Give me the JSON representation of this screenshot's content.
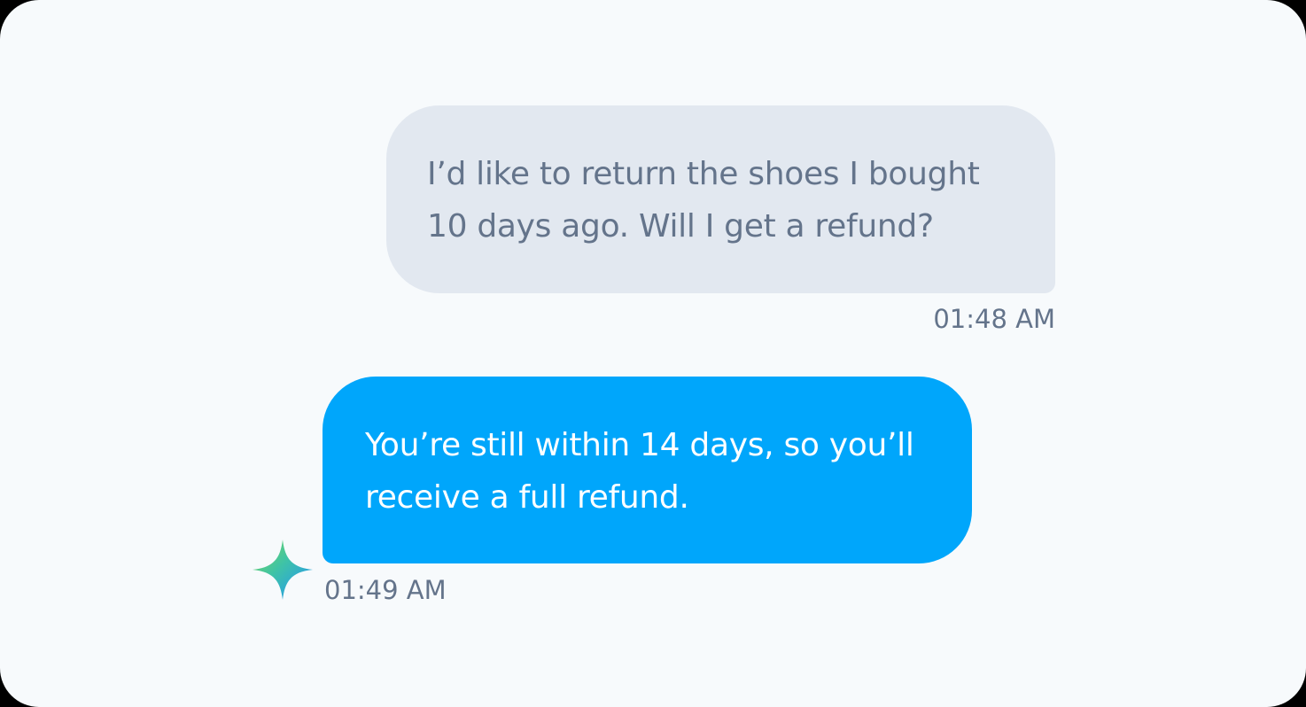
{
  "colors": {
    "background": "#f7fafc",
    "user_bubble": "#e2e8f0",
    "user_text": "#64748b",
    "ai_bubble": "#00a6fb",
    "ai_text": "#ffffff",
    "timestamp": "#64748b"
  },
  "messages": [
    {
      "sender": "user",
      "text": "I’d like to return the shoes I bought 10 days ago. Will I get a refund?",
      "time": "01:48 AM"
    },
    {
      "sender": "assistant",
      "text": "You’re still within 14 days, so you’ll receive a full refund.",
      "time": "01:49 AM",
      "avatar_icon": "sparkle-icon"
    }
  ]
}
